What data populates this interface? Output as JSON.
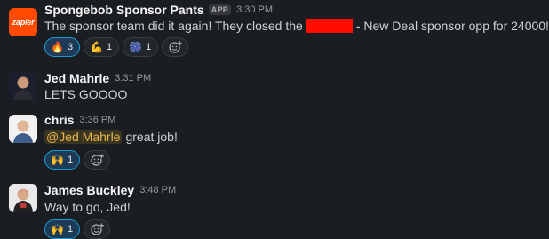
{
  "messages": [
    {
      "sender": "Spongebob Sponsor Pants",
      "badge": "APP",
      "time": "3:30 PM",
      "avatar_text": "zapier",
      "text_before": "The sponsor team did it again! They closed the",
      "text_after": "- New Deal sponsor opp for 24000!",
      "reactions": [
        {
          "emoji": "🔥",
          "count": "3",
          "icon": "fire-icon"
        },
        {
          "emoji": "💪",
          "count": "1",
          "icon": "flexed-biceps-icon"
        },
        {
          "emoji": "🎆",
          "count": "1",
          "icon": "fireworks-icon"
        }
      ]
    },
    {
      "sender": "Jed Mahrle",
      "time": "3:31 PM",
      "text": "LETS GOOOO"
    },
    {
      "sender": "chris",
      "time": "3:36 PM",
      "mention": "@Jed Mahrle",
      "text": "great job!",
      "reactions": [
        {
          "emoji": "🙌",
          "count": "1",
          "icon": "raised-hands-icon"
        }
      ]
    },
    {
      "sender": "James Buckley",
      "time": "3:48 PM",
      "text": "Way to go, Jed!",
      "reactions": [
        {
          "emoji": "🙌",
          "count": "1",
          "icon": "raised-hands-icon"
        }
      ]
    }
  ],
  "colors": {
    "background": "#1a1d21",
    "mention_text": "#e8b64a",
    "zapier_brand": "#ff4a00",
    "reaction_active_border": "#1d9bd1",
    "redaction": "#ff0d00"
  }
}
